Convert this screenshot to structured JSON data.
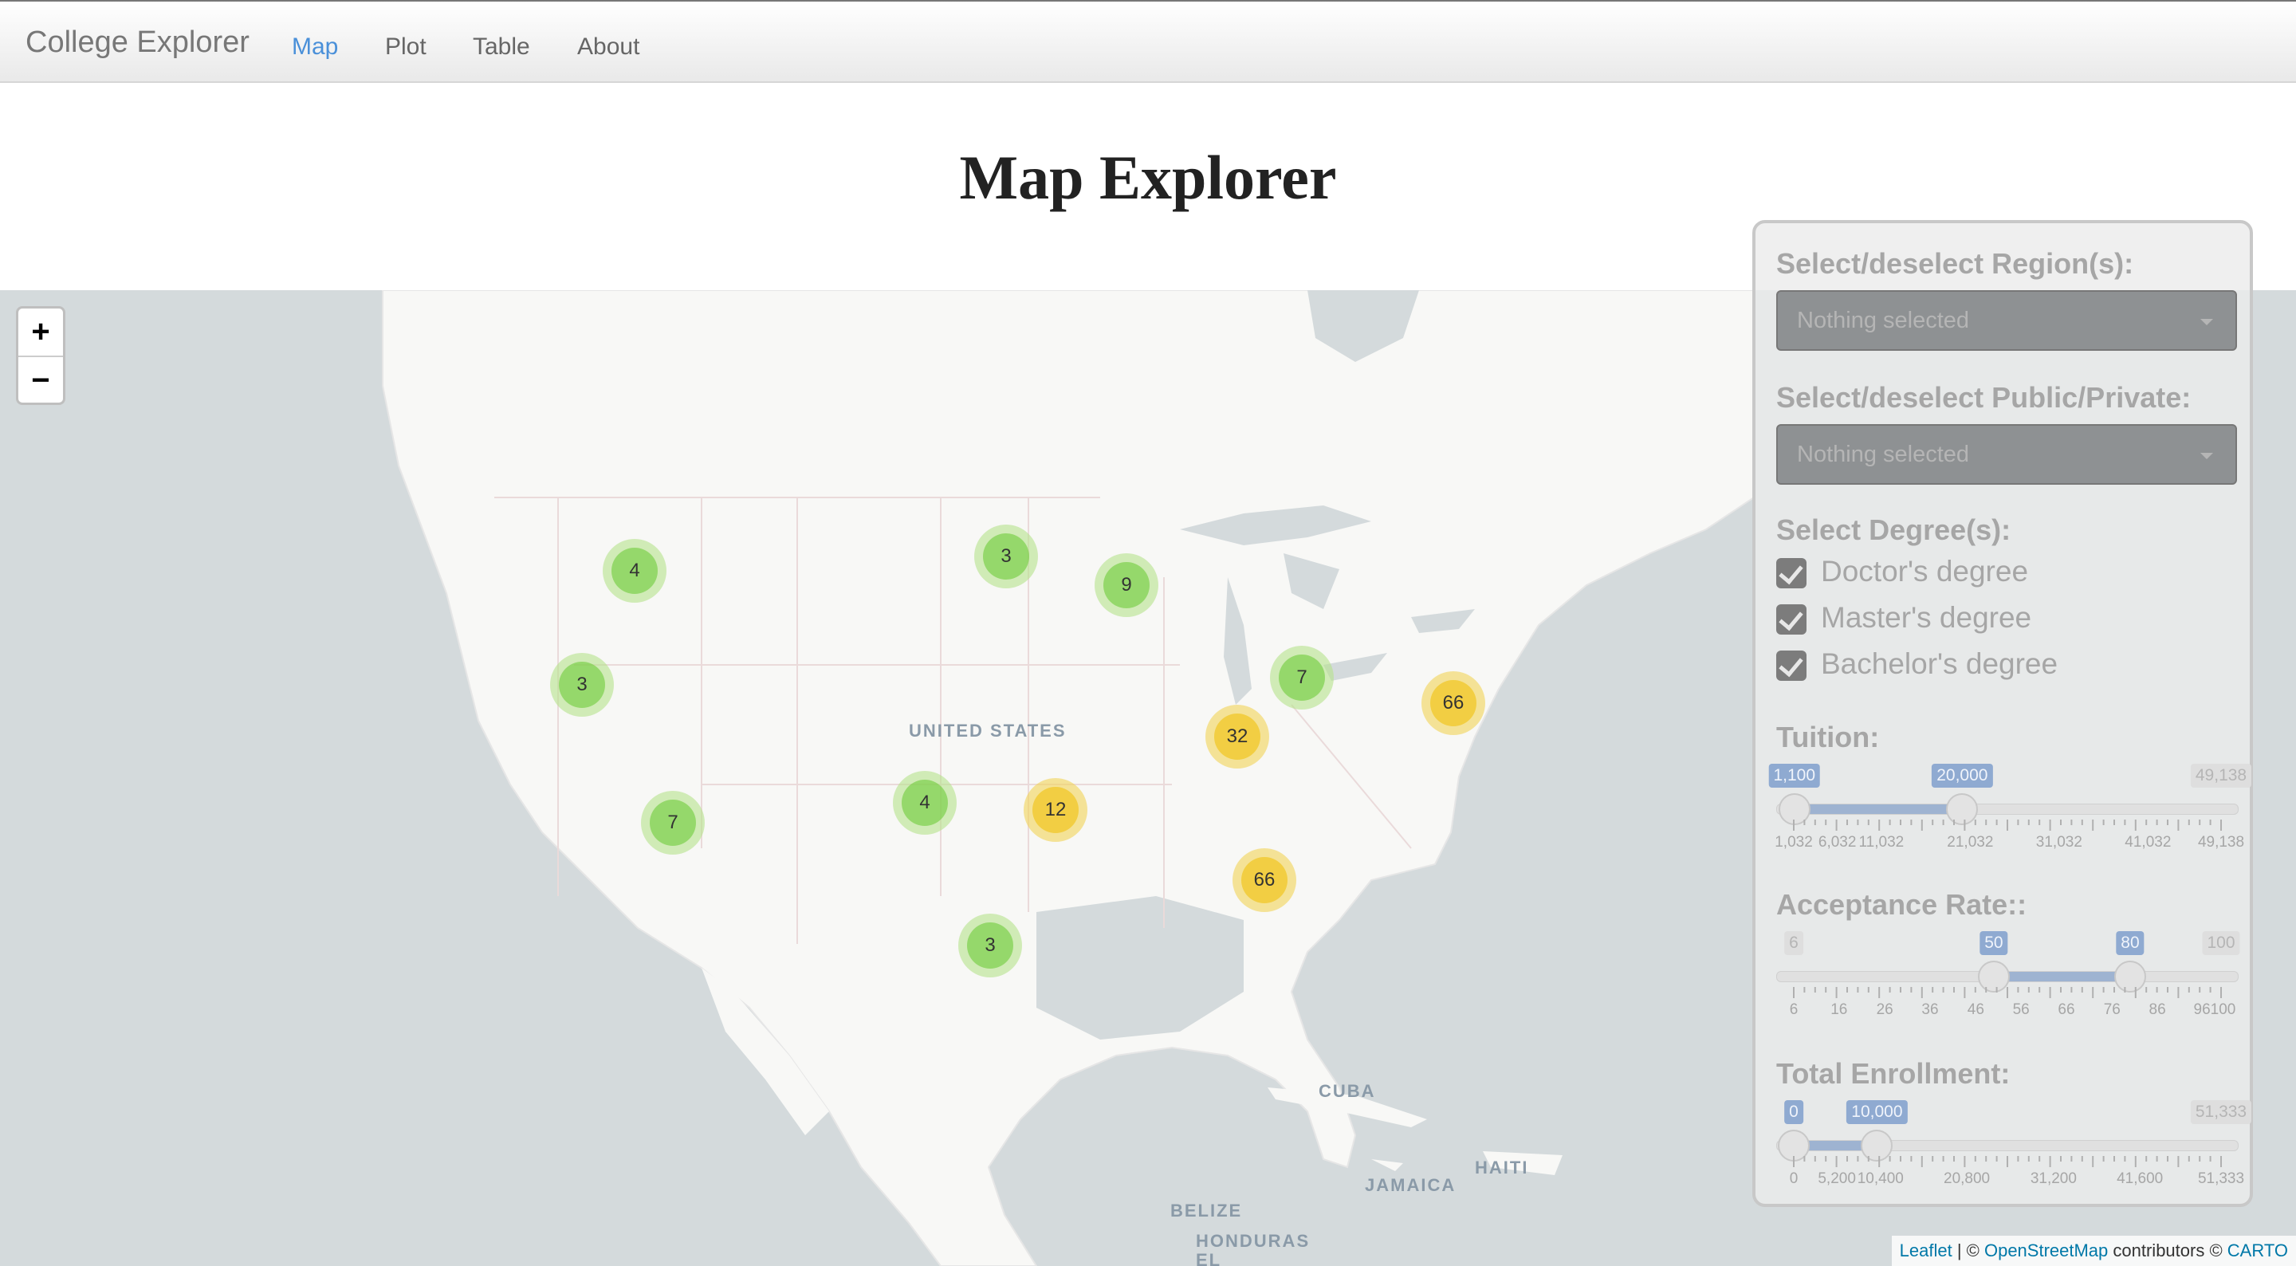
{
  "navbar": {
    "brand": "College Explorer",
    "items": [
      {
        "label": "Map",
        "active": true
      },
      {
        "label": "Plot",
        "active": false
      },
      {
        "label": "Table",
        "active": false
      },
      {
        "label": "About",
        "active": false
      }
    ]
  },
  "page_title": "Map Explorer",
  "map": {
    "zoom_in": "+",
    "zoom_out": "−",
    "labels": {
      "united_states": "UNITED STATES",
      "cuba": "CUBA",
      "jamaica": "JAMAICA",
      "haiti": "HAITI",
      "belize": "BELIZE",
      "honduras": "HONDURAS",
      "el_salvador": "EL"
    },
    "clusters": [
      {
        "count": "4",
        "color": "green"
      },
      {
        "count": "3",
        "color": "green"
      },
      {
        "count": "9",
        "color": "green"
      },
      {
        "count": "3",
        "color": "green"
      },
      {
        "count": "7",
        "color": "green"
      },
      {
        "count": "66",
        "color": "yellow"
      },
      {
        "count": "32",
        "color": "yellow"
      },
      {
        "count": "4",
        "color": "green"
      },
      {
        "count": "12",
        "color": "yellow"
      },
      {
        "count": "7",
        "color": "green"
      },
      {
        "count": "66",
        "color": "yellow"
      },
      {
        "count": "3",
        "color": "green"
      }
    ],
    "attribution": {
      "leaflet": "Leaflet",
      "sep": " | © ",
      "osm": "OpenStreetMap",
      "mid": " contributors © ",
      "carto": "CARTO"
    }
  },
  "panel": {
    "region_label": "Select/deselect Region(s):",
    "region_placeholder": "Nothing selected",
    "type_label": "Select/deselect Public/Private:",
    "type_placeholder": "Nothing selected",
    "degree_label": "Select Degree(s):",
    "degrees": [
      {
        "label": "Doctor's degree",
        "checked": true
      },
      {
        "label": "Master's degree",
        "checked": true
      },
      {
        "label": "Bachelor's degree",
        "checked": true
      }
    ],
    "tuition": {
      "label": "Tuition:",
      "min": 1032,
      "max": 49138,
      "from": 1100,
      "to": 20000,
      "from_text": "1,100",
      "to_text": "20,000",
      "min_text": "1,032",
      "max_text": "49,138",
      "tick_labels": [
        "1,032",
        "6,032",
        "11,032",
        "21,032",
        "31,032",
        "41,032",
        "49,138"
      ]
    },
    "acceptance": {
      "label": "Acceptance Rate::",
      "min": 6,
      "max": 100,
      "from": 50,
      "to": 80,
      "from_text": "50",
      "to_text": "80",
      "min_text": "6",
      "max_text": "100",
      "tick_labels": [
        "6",
        "16",
        "26",
        "36",
        "46",
        "56",
        "66",
        "76",
        "86",
        "96100"
      ]
    },
    "enrollment": {
      "label": "Total Enrollment:",
      "min": 0,
      "max": 51333,
      "from": 0,
      "to": 10000,
      "from_text": "0",
      "to_text": "10,000",
      "min_text": "0",
      "max_text": "51,333",
      "tick_labels": [
        "0",
        "5,200",
        "10,400",
        "20,800",
        "31,200",
        "41,600",
        "51,333"
      ]
    }
  },
  "colors": {
    "nav_active": "#4a90d9",
    "cluster_green": "#6ecc39",
    "cluster_yellow": "#f0c20c",
    "slider_fill": "#9eb3d1"
  }
}
